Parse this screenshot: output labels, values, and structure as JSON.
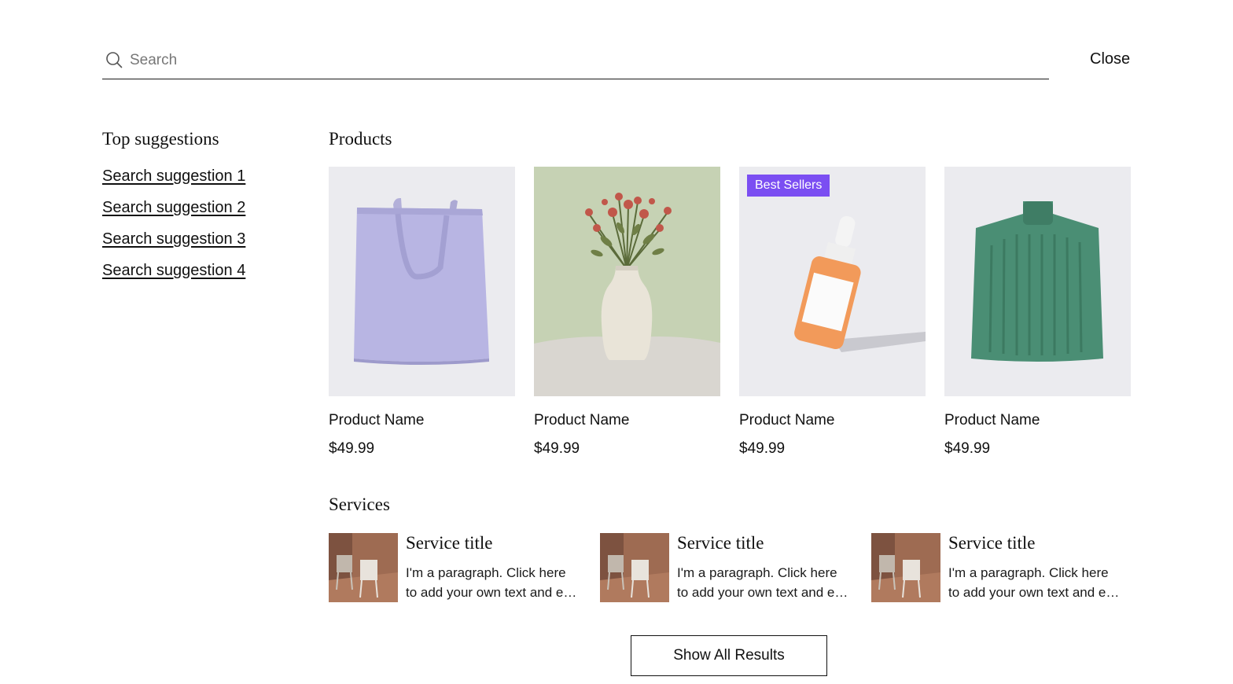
{
  "search": {
    "placeholder": "Search",
    "value": "",
    "icon": "search-icon"
  },
  "header": {
    "close_label": "Close"
  },
  "suggestions": {
    "title": "Top suggestions",
    "items": [
      {
        "label": "Search suggestion 1"
      },
      {
        "label": "Search suggestion 2"
      },
      {
        "label": "Search suggestion 3"
      },
      {
        "label": "Search suggestion 4"
      }
    ]
  },
  "products": {
    "title": "Products",
    "items": [
      {
        "name": "Product Name",
        "price": "$49.99",
        "image": "tote-bag-image"
      },
      {
        "name": "Product Name",
        "price": "$49.99",
        "image": "flower-vase-image"
      },
      {
        "name": "Product Name",
        "price": "$49.99",
        "image": "serum-bottle-image",
        "badge": "Best Sellers"
      },
      {
        "name": "Product Name",
        "price": "$49.99",
        "image": "green-sweater-image"
      }
    ]
  },
  "services": {
    "title": "Services",
    "items": [
      {
        "title": "Service title",
        "text_line1": "I'm a paragraph. Click here",
        "text_line2": "to add your own text and e…",
        "image": "chairs-image"
      },
      {
        "title": "Service title",
        "text_line1": "I'm a paragraph. Click here",
        "text_line2": "to add your own text and e…",
        "image": "chairs-image"
      },
      {
        "title": "Service title",
        "text_line1": "I'm a paragraph. Click here",
        "text_line2": "to add your own text and e…",
        "image": "chairs-image"
      }
    ]
  },
  "footer": {
    "show_all_label": "Show All Results"
  },
  "colors": {
    "badge": "#7b4ef2",
    "product_bg": "#ebebef",
    "vase_bg": "#c6d2b4"
  }
}
